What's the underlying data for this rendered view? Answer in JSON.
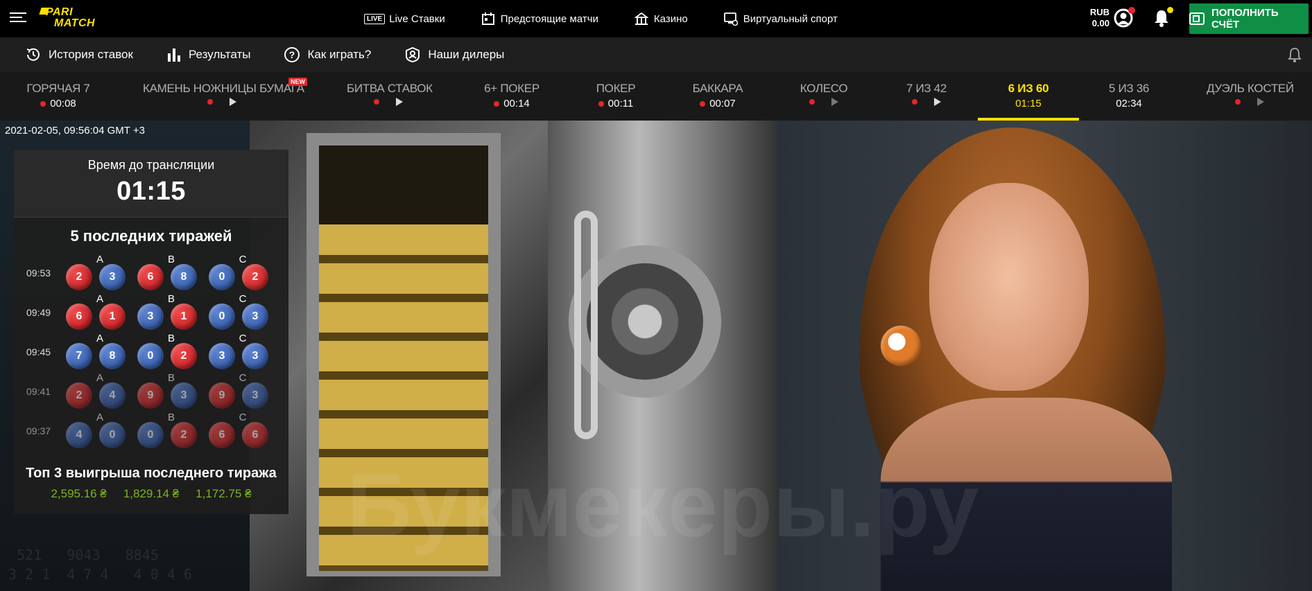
{
  "header": {
    "logo_line1": "PARI",
    "logo_line2": "MATCH",
    "nav": [
      {
        "label": "Live Ставки",
        "badge": "LIVE",
        "icon": "live-icon"
      },
      {
        "label": "Предстоящие матчи",
        "icon": "calendar-icon"
      },
      {
        "label": "Казино",
        "icon": "casino-icon"
      },
      {
        "label": "Виртуальный спорт",
        "icon": "virtual-sport-icon"
      }
    ],
    "currency": "RUB",
    "balance": "0.00",
    "deposit_label": "ПОПОЛНИТЬ СЧЁТ",
    "colors": {
      "brand": "#ffe100",
      "deposit": "#0f8f45",
      "alert": "#e3262e"
    }
  },
  "subnav": [
    {
      "label": "История ставок",
      "icon": "history-icon"
    },
    {
      "label": "Результаты",
      "icon": "results-icon"
    },
    {
      "label": "Как играть?",
      "icon": "help-icon"
    },
    {
      "label": "Наши дилеры",
      "icon": "dealers-icon"
    }
  ],
  "games": [
    {
      "name": "ГОРЯЧАЯ 7",
      "timer": "00:08"
    },
    {
      "name": "КАМЕНЬ НОЖНИЦЫ БУМАГА",
      "timer": "",
      "badge": "NEW"
    },
    {
      "name": "БИТВА СТАВОК",
      "timer": ""
    },
    {
      "name": "6+ ПОКЕР",
      "timer": "00:14"
    },
    {
      "name": "ПОКЕР",
      "timer": "00:11"
    },
    {
      "name": "БАККАРА",
      "timer": "00:07"
    },
    {
      "name": "КОЛЕСО",
      "timer": ""
    },
    {
      "name": "7 ИЗ 42",
      "timer": ""
    },
    {
      "name": "6 ИЗ 60",
      "timer": "01:15",
      "active": true
    },
    {
      "name": "5 ИЗ 36",
      "timer": "02:34"
    },
    {
      "name": "ДУЭЛЬ КОСТЕЙ",
      "timer": ""
    }
  ],
  "stream": {
    "datestamp": "2021-02-05, 09:56:04 GMT +3",
    "watermark": "Букмекеры.ру"
  },
  "panel": {
    "countdown_label": "Время до трансляции",
    "countdown": "01:15",
    "draws_title": "5 последних тиражей",
    "group_labels": [
      "A",
      "B",
      "C"
    ],
    "draws": [
      {
        "time": "09:53",
        "balls": [
          [
            "2",
            "red"
          ],
          [
            "3",
            "blue"
          ],
          [
            "6",
            "red"
          ],
          [
            "8",
            "blue"
          ],
          [
            "0",
            "blue"
          ],
          [
            "2",
            "red"
          ]
        ]
      },
      {
        "time": "09:49",
        "balls": [
          [
            "6",
            "red"
          ],
          [
            "1",
            "red"
          ],
          [
            "3",
            "blue"
          ],
          [
            "1",
            "red"
          ],
          [
            "0",
            "blue"
          ],
          [
            "3",
            "blue"
          ]
        ]
      },
      {
        "time": "09:45",
        "balls": [
          [
            "7",
            "blue"
          ],
          [
            "8",
            "blue"
          ],
          [
            "0",
            "blue"
          ],
          [
            "2",
            "red"
          ],
          [
            "3",
            "blue"
          ],
          [
            "3",
            "blue"
          ]
        ]
      },
      {
        "time": "09:41",
        "balls": [
          [
            "2",
            "red"
          ],
          [
            "4",
            "blue"
          ],
          [
            "9",
            "red"
          ],
          [
            "3",
            "blue"
          ],
          [
            "9",
            "red"
          ],
          [
            "3",
            "blue"
          ]
        ]
      },
      {
        "time": "09:37",
        "balls": [
          [
            "4",
            "blue"
          ],
          [
            "0",
            "blue"
          ],
          [
            "0",
            "blue"
          ],
          [
            "2",
            "red"
          ],
          [
            "6",
            "red"
          ],
          [
            "6",
            "red"
          ]
        ]
      }
    ],
    "top3_title": "Топ 3 выигрыша последнего тиража",
    "top3": [
      "2,595.16 ₴",
      "1,829.14 ₴",
      "1,172.75 ₴"
    ]
  }
}
